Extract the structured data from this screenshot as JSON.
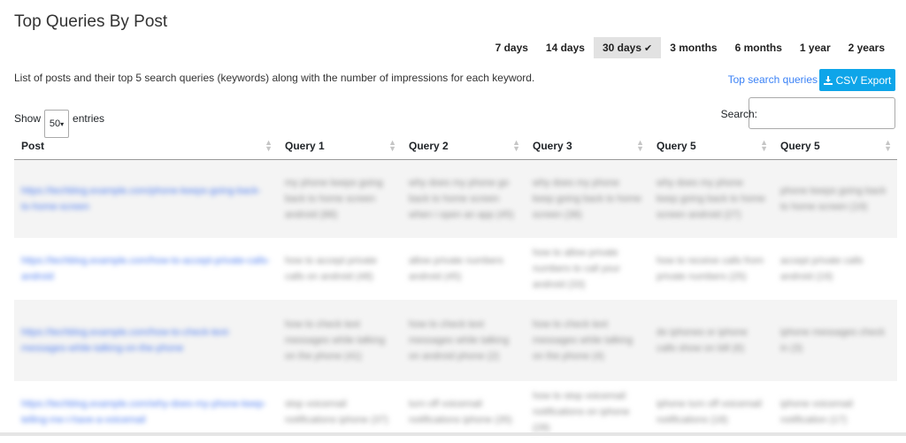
{
  "page": {
    "title": "Top Queries By Post",
    "description": "List of posts and their top 5 search queries (keywords) along with the number of impressions for each keyword."
  },
  "ranges": [
    {
      "label": "7 days",
      "active": false
    },
    {
      "label": "14 days",
      "active": false
    },
    {
      "label": "30 days",
      "active": true
    },
    {
      "label": "3 months",
      "active": false
    },
    {
      "label": "6 months",
      "active": false
    },
    {
      "label": "1 year",
      "active": false
    },
    {
      "label": "2 years",
      "active": false
    }
  ],
  "actions": {
    "top_queries_link": "Top search queries",
    "csv_export": "CSV Export"
  },
  "controls": {
    "show_label": "Show",
    "entries_value": "50",
    "entries_label": "entries",
    "search_label": "Search:"
  },
  "table": {
    "headers": [
      "Post",
      "Query 1",
      "Query 2",
      "Query 3",
      "Query 5",
      "Query 5"
    ],
    "rows": [
      [
        "https://techblog.example.com/phone-keeps-going-back-to-home-screen",
        "my phone keeps going back to home screen android (88)",
        "why does my phone go back to home screen when i open an app (45)",
        "why does my phone keep going back to home screen (38)",
        "why does my phone keep going back to home screen android (27)",
        "phone keeps going back to home screen (19)"
      ],
      [
        "https://techblog.example.com/how-to-accept-private-calls-android",
        "how to accept private calls on android (48)",
        "allow private numbers android (45)",
        "how to allow private numbers to call your android (33)",
        "how to receive calls from private numbers (25)",
        "accept private calls android (19)"
      ],
      [
        "https://techblog.example.com/how-to-check-text-messages-while-talking-on-the-phone",
        "how to check text messages while talking on the phone (41)",
        "how to check text messages while talking on android phone (2)",
        "how to check text messages while talking on the phone (4)",
        "do iphones or iphone calls show on bill (6)",
        "iphone messages check in (3)"
      ],
      [
        "https://techblog.example.com/why-does-my-phone-keep-telling-me-i-have-a-voicemail",
        "stop voicemail notifications iphone (37)",
        "turn off voicemail notifications iphone (35)",
        "how to stop voicemail notifications on iphone (28)",
        "iphone turn off voicemail notifications (18)",
        "iphone voicemail notification (17)"
      ]
    ]
  }
}
